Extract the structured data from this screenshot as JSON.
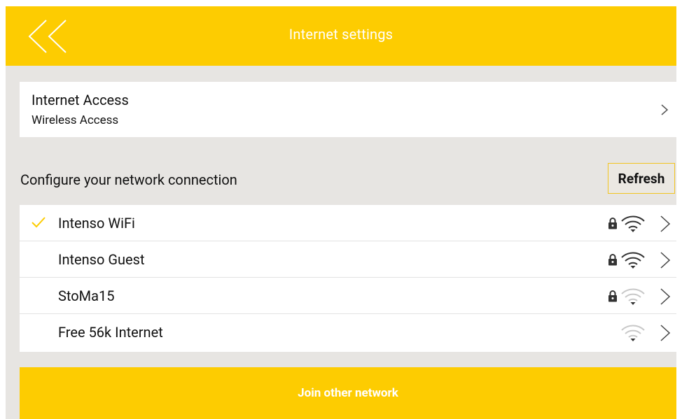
{
  "header": {
    "title": "Internet settings",
    "back_icon": "double-chevron-left-icon"
  },
  "access": {
    "title": "Internet Access",
    "subtitle": "Wireless Access"
  },
  "networks_section": {
    "label": "Configure your network connection",
    "refresh_label": "Refresh"
  },
  "networks": [
    {
      "name": "Intenso WiFi",
      "connected": true,
      "secured": true,
      "signal": 3
    },
    {
      "name": "Intenso Guest",
      "connected": false,
      "secured": true,
      "signal": 3
    },
    {
      "name": "StoMa15",
      "connected": false,
      "secured": true,
      "signal": 1
    },
    {
      "name": "Free 56k Internet",
      "connected": false,
      "secured": false,
      "signal": 1
    }
  ],
  "join_button": {
    "label": "Join other network"
  },
  "colors": {
    "accent": "#fdcc01",
    "background": "#e7e5e2",
    "signal_strong": "#333333",
    "signal_weak": "#c8c8c8"
  }
}
